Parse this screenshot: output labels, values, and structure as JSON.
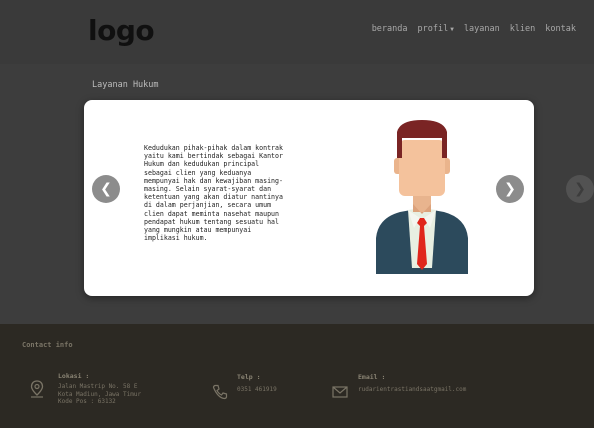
{
  "header": {
    "logo": "logo",
    "nav": {
      "beranda": "beranda",
      "profil": "profil",
      "layanan": "layanan",
      "klien": "klien",
      "kontak": "kontak"
    }
  },
  "section": {
    "title": "Layanan Hukum"
  },
  "modal": {
    "text": "Kedudukan pihak-pihak dalam kontrak\nyaitu kami bertindak sebagai Kantor\nHukum dan kedudukan principal\nsebagai clien yang keduanya\nmempunyai hak dan kewajiban masing-\nmasing. Selain syarat-syarat dan\nketentuan yang akan diatur nantinya\ndi dalam perjanjian, secara umum\nclien dapat meminta nasehat maupun\npendapat hukum tentang sesuatu hal\nyang mungkin atau mempunyai\nimplikasi hukum.",
    "illustration": "businessman-avatar"
  },
  "footer": {
    "title": "Contact info",
    "lokasi_label": "Lokasi :",
    "lokasi_value": "Jalan Mastrip No. 58 E\nKota Madiun, Jawa Timur\nKode Pos : 63132",
    "telp_label": "Telp :",
    "telp_value": "0351 461919",
    "email_label": "Email :",
    "email_value": "rudarientrastiandsaatgmail.com"
  },
  "colors": {
    "background": "#3c3c3c",
    "modal": "#ffffff",
    "footer": "#2c2923",
    "tie": "#e0261c",
    "suit": "#2c4a5c",
    "hair": "#7a2424"
  },
  "icons": [
    "chevron-left-icon",
    "chevron-right-icon",
    "location-icon",
    "phone-icon",
    "mail-icon",
    "caret-down-icon"
  ]
}
